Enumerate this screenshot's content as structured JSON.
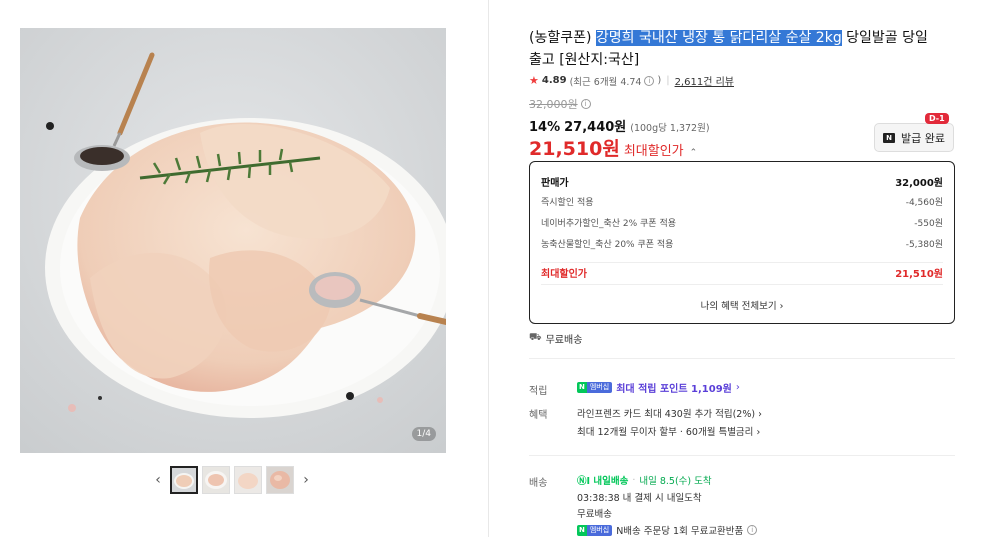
{
  "gallery": {
    "counter": "1/4",
    "prev_icon": "chevron-left-icon",
    "next_icon": "chevron-right-icon",
    "thumbnail_count": 4
  },
  "product": {
    "title_prefix": "(농할쿠폰) ",
    "title_highlight": "강명희 국내산 냉장 통 닭다리살 순살 2kg",
    "title_suffix": " 당일발골 당일출고 [원산지:국산]"
  },
  "rating": {
    "score": "4.89",
    "recent": "(최근 6개월 4.74",
    "recent_close": ")",
    "reviews": "2,611건 리뷰"
  },
  "price": {
    "original": "32,000원",
    "discount": "14%",
    "sale": "27,440원",
    "unit_price": "(100g당 1,372원)",
    "max_price": "21,510원",
    "max_label": "최대할인가",
    "coupon_button": "발급 완료",
    "coupon_badge": "D-1"
  },
  "breakdown": {
    "rows": [
      {
        "label": "판매가",
        "value": "32,000원"
      },
      {
        "label": "즉시할인 적용",
        "value": "-4,560원"
      },
      {
        "label": "네이버추가할인_축산 2% 쿠폰 적용",
        "value": "-550원"
      },
      {
        "label": "농축산물할인_축산 20% 쿠폰 적용",
        "value": "-5,380원"
      }
    ],
    "max_label": "최대할인가",
    "max_value": "21,510원",
    "view_all": "나의 혜택 전체보기"
  },
  "shipping_free": "무료배송",
  "benefits": {
    "label_1": "적립",
    "label_2": "혜택",
    "n_badge": "N",
    "membership": "멤버십",
    "point_text": "최대 적립 포인트 1,109원",
    "card_line": "라인프렌즈 카드 최대 430원 추가 적립(2%)",
    "installment": "최대 12개월 무이자 할부 · 60개월 특별금리"
  },
  "delivery": {
    "label": "배송",
    "tomorrow": "내일배송",
    "date": "내일 8.5(수) 도착",
    "cutoff": "03:38:38  내 결제 시 내일도착",
    "free": "무료배송",
    "exchange": "N배송 주문당 1회 무료교환반품"
  },
  "colors": {
    "accent_red": "#e02a2a",
    "highlight_blue": "#3478d6",
    "naver_green": "#03c75a",
    "point_purple": "#5a3fd8"
  }
}
